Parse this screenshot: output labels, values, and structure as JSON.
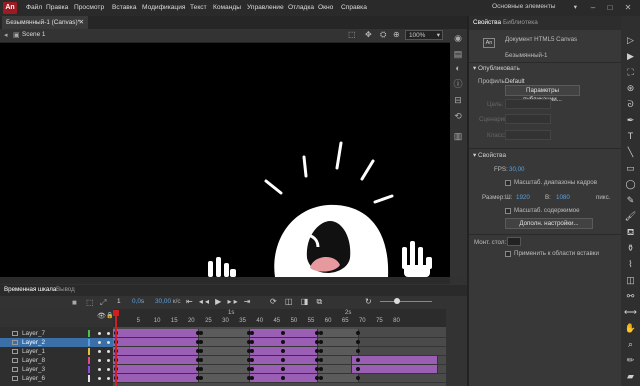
{
  "app": {
    "logo": "An"
  },
  "menu": [
    "Файл",
    "Правка",
    "Просмотр",
    "Вставка",
    "Модификация",
    "Текст",
    "Команды",
    "Управление",
    "Отладка",
    "Окно",
    "Справка"
  ],
  "workspace": "Основные элементы",
  "document_tab": "Безымянный-1 (Canvas)*",
  "stage": {
    "scene": "Scene 1",
    "zoom": "100%"
  },
  "timeline": {
    "tabs": [
      "Временная шкала",
      "Вывод"
    ],
    "current_frame": "0,0",
    "frame_unit": "s",
    "fps": "30,00",
    "fps_unit": "к/с",
    "frame_number": "1",
    "ruler_labels": [
      {
        "f": "5"
      },
      {
        "f": "10"
      },
      {
        "f": "15"
      },
      {
        "f": "20"
      },
      {
        "f": "25"
      },
      {
        "f": "30"
      },
      {
        "f": "35"
      },
      {
        "f": "40"
      },
      {
        "f": "45"
      },
      {
        "f": "50"
      },
      {
        "f": "55"
      },
      {
        "f": "60"
      },
      {
        "f": "65"
      },
      {
        "f": "70"
      },
      {
        "f": "75"
      },
      {
        "f": "80"
      }
    ],
    "ruler_seconds": [
      "1s",
      "2s"
    ],
    "layers": [
      "Layer_7",
      "Layer_2",
      "Layer_1",
      "Layer_8",
      "Layer_3",
      "Layer_6"
    ],
    "selected_layer": "Layer_2",
    "layer_colors": [
      "#4ec04e",
      "#4aa5e0",
      "#e0c040",
      "#e04a8c",
      "#8d4ae0",
      "#e0e0e0"
    ]
  },
  "properties": {
    "tabs": [
      "Свойства",
      "Библиотека"
    ],
    "doc_type": "Документ HTML5 Canvas",
    "doc_name": "Безымянный-1",
    "publish_section": "Опубликовать",
    "profile_label": "Профиль:",
    "profile_value": "Default",
    "publish_settings_btn": "Параметры публикации...",
    "disabled_labels": [
      "Цель:",
      "Сценарий:",
      "Класс:"
    ],
    "props_section": "Свойства",
    "fps_label": "FPS:",
    "fps_value": "30,00",
    "scale_ranges_label": "Масштаб. диапазоны кадров",
    "size_label": "Размер:",
    "w_label": "Ш:",
    "w_value": "1920",
    "h_label": "В:",
    "h_value": "1080",
    "unit": "пикс.",
    "scale_content_label": "Масштаб. содержимое",
    "more_settings_btn": "Дополн. настройки...",
    "stage_label": "Монт. стол:",
    "apply_to_paste_label": "Применить к области вставки"
  },
  "tools": [
    "selection-arrow",
    "subselect-arrow",
    "free-transform",
    "3d-rotation",
    "lasso",
    "pen",
    "text",
    "line",
    "rectangle",
    "oval",
    "pencil",
    "brush",
    "paint-bucket",
    "ink-bottle",
    "eyedropper",
    "eraser",
    "bone",
    "width",
    "hand",
    "zoom",
    "stroke-color",
    "fill-color"
  ],
  "colors": {
    "keyframe_span": "#9a5fb4",
    "selected_layer": "#3b6fa8",
    "playhead": "#d21e1e",
    "logo": "#9b1b23"
  }
}
